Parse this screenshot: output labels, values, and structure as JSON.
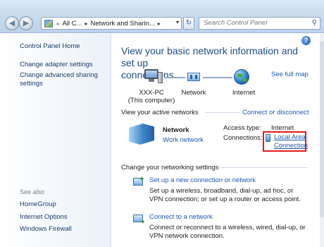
{
  "titlebar": {
    "recent_glyph": "«",
    "breadcrumbs": [
      "All C...",
      "Network and Sharin..."
    ],
    "separator_glyph": "▸",
    "search_placeholder": "Search Control Panel",
    "refresh_glyph": "↻",
    "search_glyph": "⚲",
    "back_glyph": "◀",
    "forward_glyph": "▶",
    "dropdown_glyph": "▾"
  },
  "left_pane": {
    "home": "Control Panel Home",
    "links": [
      "Change adapter settings",
      "Change advanced sharing",
      "settings"
    ],
    "see_also_label": "See also",
    "see_also": [
      "HomeGroup",
      "Internet Options",
      "Windows Firewall"
    ]
  },
  "main": {
    "help_glyph": "?",
    "heading_line1": "View your basic network information and set up",
    "heading_line2": "connections",
    "see_full_map": "See full map",
    "map": {
      "computer_name": "XXX-PC",
      "computer_sub": "(This computer)",
      "network_label": "Network",
      "internet_label": "Internet"
    },
    "active_networks": {
      "title": "View your active networks",
      "connect_link": "Connect or disconnect",
      "network_name": "Network",
      "network_type": "Work network",
      "access_type_label": "Access type:",
      "access_type_value": "Internet",
      "connections_label": "Connections:",
      "connection_line1": "Local Area",
      "connection_line2": "Connection"
    },
    "change_settings": {
      "title": "Change your networking settings",
      "tasks": [
        {
          "link": "Set up a new connection or network",
          "desc": "Set up a wireless, broadband, dial-up, ad hoc, or VPN connection; or set up a router or access point."
        },
        {
          "link": "Connect to a network",
          "desc": "Connect or reconnect to a wireless, wired, dial-up, or VPN network connection."
        }
      ]
    }
  },
  "icons": {
    "back": "back-arrow-icon",
    "forward": "forward-arrow-icon",
    "refresh": "refresh-icon",
    "search": "search-icon",
    "help": "help-icon",
    "computer": "computer-icon",
    "network": "network-icon",
    "internet": "globe-icon",
    "active_network": "network-bench-icon",
    "connection": "ethernet-icon",
    "new_connection": "new-connection-icon",
    "connect_network": "connect-network-icon"
  }
}
